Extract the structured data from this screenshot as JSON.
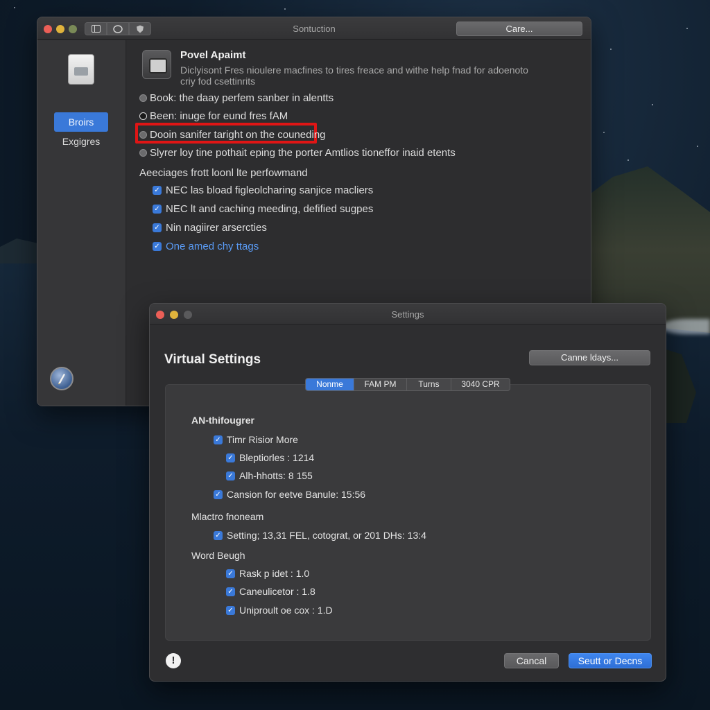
{
  "window1": {
    "title": "Sontuction",
    "toolbar_icons": [
      "sidebar-icon",
      "circle-icon",
      "shield-icon"
    ],
    "top_button": "Care...",
    "sidebar": {
      "selected": "Broirs",
      "item": "Exgigres"
    },
    "header": {
      "title": "Povel Apaimt",
      "description": "Diclyisont Fres nioulere macfines to tires freace and withe help fnad for adoenoto criy fod csettinrits"
    },
    "radio_options": [
      "Book: the daay perfem sanber in alentts",
      "Been: inuge for eund fres fAM",
      "Dooin sanifer taright on the couneding",
      "Slyrer loy tine pothait eping the porter Amtlios tioneffor inaid etents"
    ],
    "section_label": "Aeeciages frott loonl lte perfowmand",
    "checkbox_options": [
      "NEC las bload figleolcharing sanjice macliers",
      "NEC lt and caching meeding, defified sugpes",
      "Nin nagiirer arsercties",
      "One amed chy ttags"
    ]
  },
  "window2": {
    "title": "Settings",
    "heading": "Virtual Settings",
    "top_button": "Canne ldays...",
    "tabs": [
      "Nonme",
      "FAM PM",
      "Turns",
      "3040 CPR"
    ],
    "sections": [
      {
        "label": "AN-thifougrer",
        "items": [
          {
            "text": "Timr Risior More",
            "level": 1
          },
          {
            "text": "Bleptiorles : 1214",
            "level": 2
          },
          {
            "text": "Alh-hhotts: 8 155",
            "level": 2
          },
          {
            "text": "Cansion for eetve Banule: 15:56",
            "level": 1
          }
        ]
      },
      {
        "label": "Mlactro fnoneam",
        "items": [
          {
            "text": "Setting; 13,31 FEL, cotograt, or 201 DHs: 13:4",
            "level": 1
          }
        ]
      },
      {
        "label": "Word Beugh",
        "items": [
          {
            "text": "Rask p idet : 1.0",
            "level": 2
          },
          {
            "text": "Caneulicetor : 1.8",
            "level": 2
          },
          {
            "text": "Uniproult oe cox : 1.D",
            "level": 2
          }
        ]
      }
    ],
    "footer": {
      "cancel": "Cancal",
      "primary": "Seutt or Decns"
    }
  },
  "colors": {
    "accent": "#3a79d9",
    "highlight": "#e01515",
    "link": "#5a9bf5"
  }
}
